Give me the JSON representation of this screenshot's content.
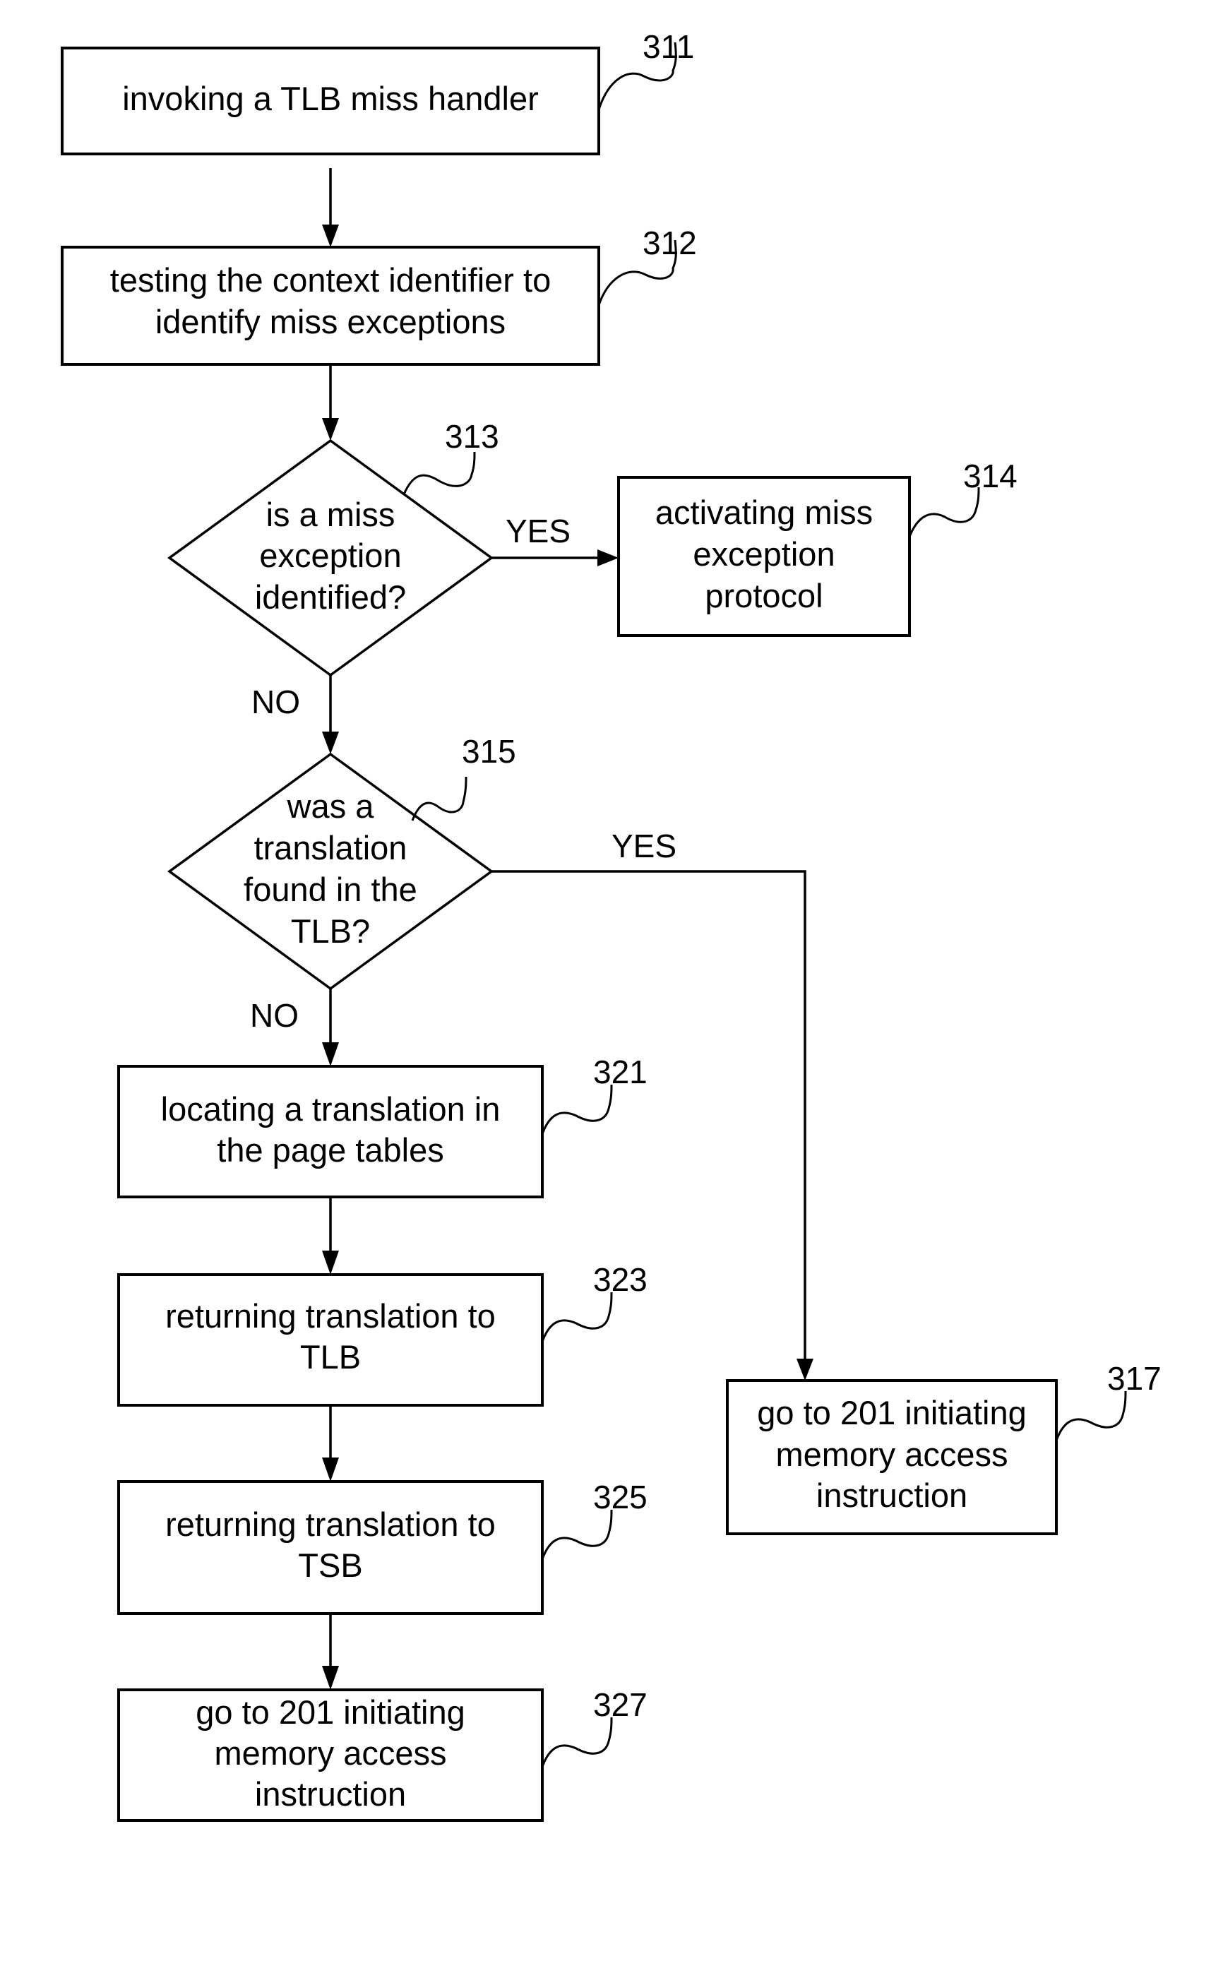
{
  "nodes": {
    "n311": {
      "ref": "311",
      "lines": [
        "invoking a TLB miss handler"
      ]
    },
    "n312": {
      "ref": "312",
      "lines": [
        "testing the context identifier to",
        "identify miss exceptions"
      ]
    },
    "n313": {
      "ref": "313",
      "lines": [
        "is a miss",
        "exception",
        "identified?"
      ]
    },
    "n314": {
      "ref": "314",
      "lines": [
        "activating miss",
        "exception",
        "protocol"
      ]
    },
    "n315": {
      "ref": "315",
      "lines": [
        "was a",
        "translation",
        "found in the",
        "TLB?"
      ]
    },
    "n317": {
      "ref": "317",
      "lines": [
        "go to 201 initiating",
        "memory access",
        "instruction"
      ]
    },
    "n321": {
      "ref": "321",
      "lines": [
        "locating a translation in",
        "the page tables"
      ]
    },
    "n323": {
      "ref": "323",
      "lines": [
        "returning translation to",
        "TLB"
      ]
    },
    "n325": {
      "ref": "325",
      "lines": [
        "returning translation to",
        "TSB"
      ]
    },
    "n327": {
      "ref": "327",
      "lines": [
        "go to 201 initiating",
        "memory access",
        "instruction"
      ]
    }
  },
  "edge_labels": {
    "yes_313": "YES",
    "no_313": "NO",
    "yes_315": "YES",
    "no_315": "NO"
  }
}
